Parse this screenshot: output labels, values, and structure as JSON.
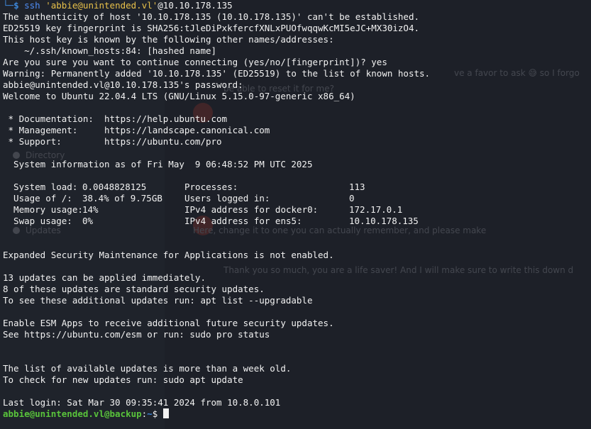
{
  "terminal": {
    "first_command": {
      "prompt_symbol": "$",
      "command": "ssh",
      "quoted_arg": "'abbie@unintended.vl'",
      "target": "@10.10.178.135"
    },
    "lines": [
      "The authenticity of host '10.10.178.135 (10.10.178.135)' can't be established.",
      "ED25519 key fingerprint is SHA256:tJleDiPxkfercfXNLxPUOfwqqwKcMI5eJC+MX30izO4.",
      "This host key is known by the following other names/addresses:",
      "    ~/.ssh/known_hosts:84: [hashed name]",
      "Are you sure you want to continue connecting (yes/no/[fingerprint])? yes",
      "Warning: Permanently added '10.10.178.135' (ED25519) to the list of known hosts.",
      "abbie@unintended.vl@10.10.178.135's password:",
      "Welcome to Ubuntu 22.04.4 LTS (GNU/Linux 5.15.0-97-generic x86_64)",
      "",
      " * Documentation:  https://help.ubuntu.com",
      " * Management:     https://landscape.canonical.com",
      " * Support:        https://ubuntu.com/pro",
      "",
      "  System information as of Fri May  9 06:48:52 PM UTC 2025",
      ""
    ],
    "sysinfo": [
      {
        "k1": "  System load:",
        "v1": "0.0048828125",
        "k2": "Processes:",
        "v2": "113"
      },
      {
        "k1": "  Usage of /:",
        "v1": "38.4% of 9.75GB",
        "k2": "Users logged in:",
        "v2": "0"
      },
      {
        "k1": "  Memory usage:",
        "v1": "14%",
        "k2": "IPv4 address for docker0:",
        "v2": "172.17.0.1"
      },
      {
        "k1": "  Swap usage:",
        "v1": "0%",
        "k2": "IPv4 address for ens5:",
        "v2": "10.10.178.135"
      }
    ],
    "lines_after": [
      "",
      "",
      "Expanded Security Maintenance for Applications is not enabled.",
      "",
      "13 updates can be applied immediately.",
      "8 of these updates are standard security updates.",
      "To see these additional updates run: apt list --upgradable",
      "",
      "Enable ESM Apps to receive additional future security updates.",
      "See https://ubuntu.com/esm or run: sudo pro status",
      "",
      "",
      "The list of available updates is more than a week old.",
      "To check for new updates run: sudo apt update",
      "",
      "Last login: Sat Mar 30 09:35:41 2024 from 10.8.0.101"
    ],
    "final_prompt": {
      "user_host": "abbie@unintended.vl@backup",
      "separator": ":",
      "path": "~",
      "symbol": "$"
    }
  },
  "background_app": {
    "sidebar_items": [
      "Directory",
      "Updates"
    ],
    "messages": [
      "ve a favor to ask 😅 so I forgo",
      "be able to reset it for me?",
      "Here, change it to one you can actually remember, and please make",
      "Thank you so much, you are a life saver! And I will make sure to write this down d"
    ]
  }
}
